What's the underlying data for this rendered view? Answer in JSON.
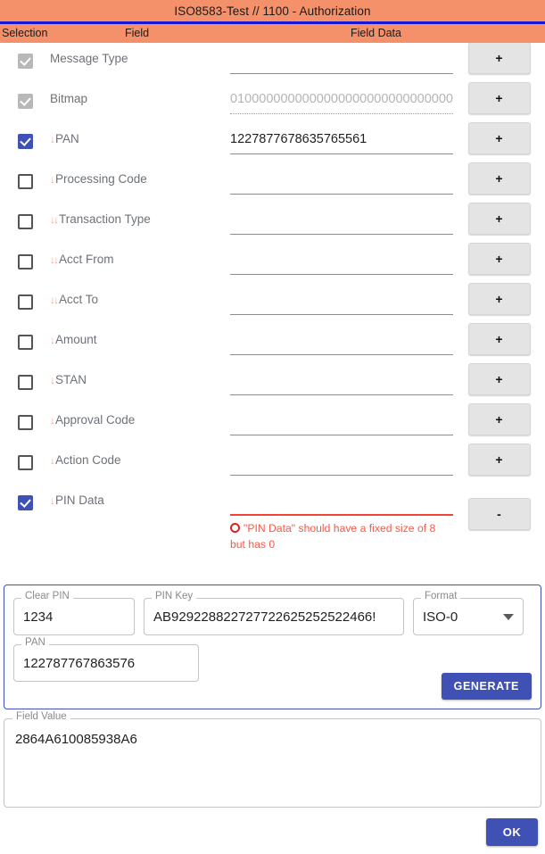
{
  "window": {
    "title": "ISO8583-Test // 1100 - Authorization"
  },
  "columns": {
    "selection": "Selection",
    "field": "Field",
    "field_data": "Field Data"
  },
  "colors": {
    "header_bg": "#f4916a",
    "header_rule": "#1616d8",
    "accent": "#3f51b5",
    "error": "#f44336",
    "arrow": "#eeaa90"
  },
  "rows": [
    {
      "label": "Message Type",
      "arrow": "",
      "checkbox": "disabled-checked",
      "value": "",
      "placeholder": false,
      "underline": "solid",
      "button": "+"
    },
    {
      "label": "Bitmap",
      "arrow": "",
      "checkbox": "disabled-checked",
      "value": "01000000000000000000000000000000",
      "placeholder": true,
      "underline": "dotted",
      "button": "+"
    },
    {
      "label": "PAN",
      "arrow": "↓",
      "checkbox": "checked",
      "value": "1227877678635765561",
      "placeholder": false,
      "underline": "solid",
      "button": "+"
    },
    {
      "label": "Processing Code",
      "arrow": "↓",
      "checkbox": "unchecked",
      "value": "",
      "placeholder": false,
      "underline": "solid",
      "button": "+"
    },
    {
      "label": "Transaction Type",
      "arrow": "↓↓",
      "checkbox": "unchecked",
      "value": "",
      "placeholder": false,
      "underline": "solid",
      "button": "+"
    },
    {
      "label": "Acct From",
      "arrow": "↓↓",
      "checkbox": "unchecked",
      "value": "",
      "placeholder": false,
      "underline": "solid",
      "button": "+"
    },
    {
      "label": "Acct To",
      "arrow": "↓↓",
      "checkbox": "unchecked",
      "value": "",
      "placeholder": false,
      "underline": "solid",
      "button": "+"
    },
    {
      "label": "Amount",
      "arrow": "↓",
      "checkbox": "unchecked",
      "value": "",
      "placeholder": false,
      "underline": "solid",
      "button": "+"
    },
    {
      "label": "STAN",
      "arrow": "↓",
      "checkbox": "unchecked",
      "value": "",
      "placeholder": false,
      "underline": "solid",
      "button": "+"
    },
    {
      "label": "Approval Code",
      "arrow": "↓",
      "checkbox": "unchecked",
      "value": "",
      "placeholder": false,
      "underline": "solid",
      "button": "+"
    },
    {
      "label": "Action Code",
      "arrow": "↓",
      "checkbox": "unchecked",
      "value": "",
      "placeholder": false,
      "underline": "solid",
      "button": "+"
    },
    {
      "label": "PIN Data",
      "arrow": "↓",
      "checkbox": "checked",
      "value": "",
      "placeholder": false,
      "underline": "error",
      "button": "-",
      "error": "\"PIN Data\" should have a fixed size of 8 but has 0"
    }
  ],
  "generator": {
    "clear_pin": {
      "label": "Clear PIN",
      "value": "1234"
    },
    "pin_key": {
      "label": "PIN Key",
      "value": "AB929228822727722625252522466!"
    },
    "format": {
      "label": "Format",
      "value": "ISO-0"
    },
    "pan": {
      "label": "PAN",
      "value": "122787767863576"
    },
    "generate_label": "GENERATE"
  },
  "field_value": {
    "label": "Field Value",
    "value": "2864A610085938A6"
  },
  "footer": {
    "ok_label": "OK"
  }
}
